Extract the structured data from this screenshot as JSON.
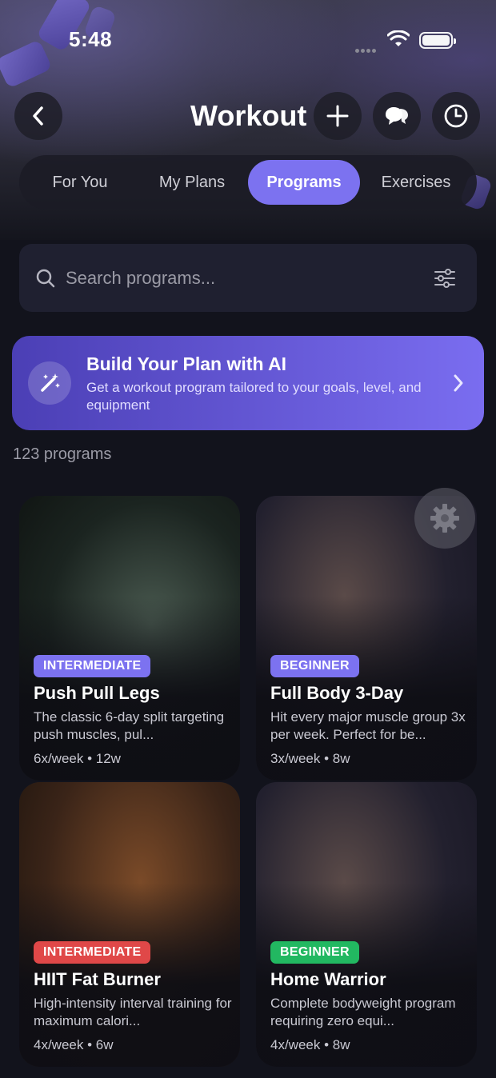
{
  "status_bar": {
    "time": "5:48"
  },
  "header": {
    "title": "Workout"
  },
  "tabs": [
    {
      "label": "For You"
    },
    {
      "label": "My Plans"
    },
    {
      "label": "Programs"
    },
    {
      "label": "Exercises"
    }
  ],
  "search": {
    "placeholder": "Search programs..."
  },
  "ai_banner": {
    "title": "Build Your Plan with AI",
    "subtitle": "Get a workout program tailored to your goals, level, and equipment"
  },
  "programs_count": "123 programs",
  "programs": [
    {
      "level": "INTERMEDIATE",
      "title": "Push Pull Legs",
      "description": "The classic 6-day split targeting push muscles, pul...",
      "meta": "6x/week • 12w",
      "badge_color": "#7c72f0"
    },
    {
      "level": "BEGINNER",
      "title": "Full Body 3-Day",
      "description": "Hit every major muscle group 3x per week. Perfect for be...",
      "meta": "3x/week • 8w",
      "badge_color": "#7c72f0"
    },
    {
      "level": "INTERMEDIATE",
      "title": "HIIT Fat Burner",
      "description": "High-intensity interval training for maximum calori...",
      "meta": "4x/week • 6w",
      "badge_color": "#e04848"
    },
    {
      "level": "BEGINNER",
      "title": "Home Warrior",
      "description": "Complete bodyweight program requiring zero equi...",
      "meta": "4x/week • 8w",
      "badge_color": "#22b861"
    }
  ]
}
